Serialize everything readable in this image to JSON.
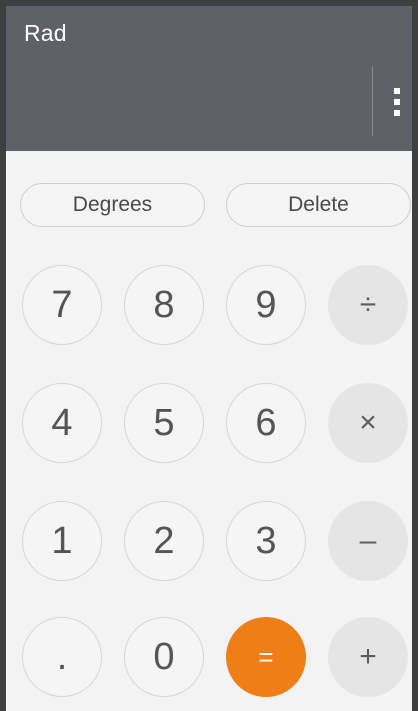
{
  "display": {
    "mode_label": "Rad",
    "menu_icon": "overflow-menu-icon"
  },
  "actions": {
    "degrees_label": "Degrees",
    "delete_label": "Delete"
  },
  "keys": {
    "k7": "7",
    "k8": "8",
    "k9": "9",
    "divide": "÷",
    "k4": "4",
    "k5": "5",
    "k6": "6",
    "multiply": "×",
    "k1": "1",
    "k2": "2",
    "k3": "3",
    "minus": "–",
    "dot": ".",
    "k0": "0",
    "equals": "=",
    "plus": "+"
  },
  "colors": {
    "display_bg": "#5f6068",
    "equals_accent": "#f07e16"
  }
}
